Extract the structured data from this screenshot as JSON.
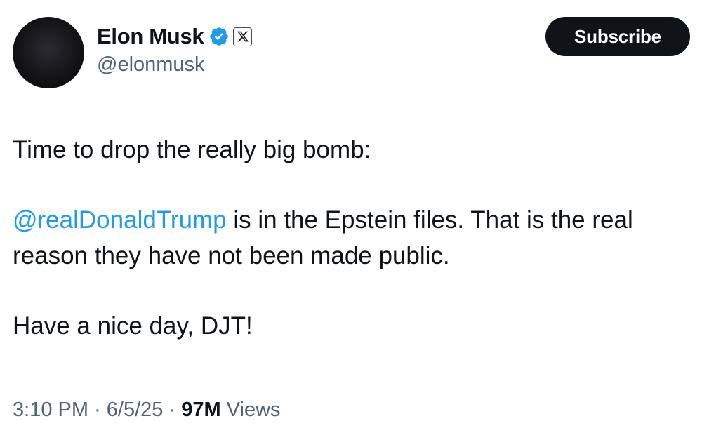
{
  "author": {
    "display_name": "Elon Musk",
    "handle": "@elonmusk",
    "verified": true,
    "verified_color": "#1d9bf0",
    "affiliate_badge": "X"
  },
  "header": {
    "subscribe_label": "Subscribe"
  },
  "tweet": {
    "line_1": "Time to drop the really big bomb:",
    "mention": "@realDonaldTrump",
    "line_2_rest": " is in the Epstein files. That is the real reason they have not been made public.",
    "line_3": "Have a nice day, DJT!"
  },
  "meta": {
    "time": "3:10 PM",
    "separator": " · ",
    "date": "6/5/25",
    "views_count": "97M",
    "views_label": " Views"
  },
  "colors": {
    "link": "#1d9bf0",
    "text": "#0f1419",
    "secondary": "#536471",
    "button_bg": "#0f1419"
  }
}
